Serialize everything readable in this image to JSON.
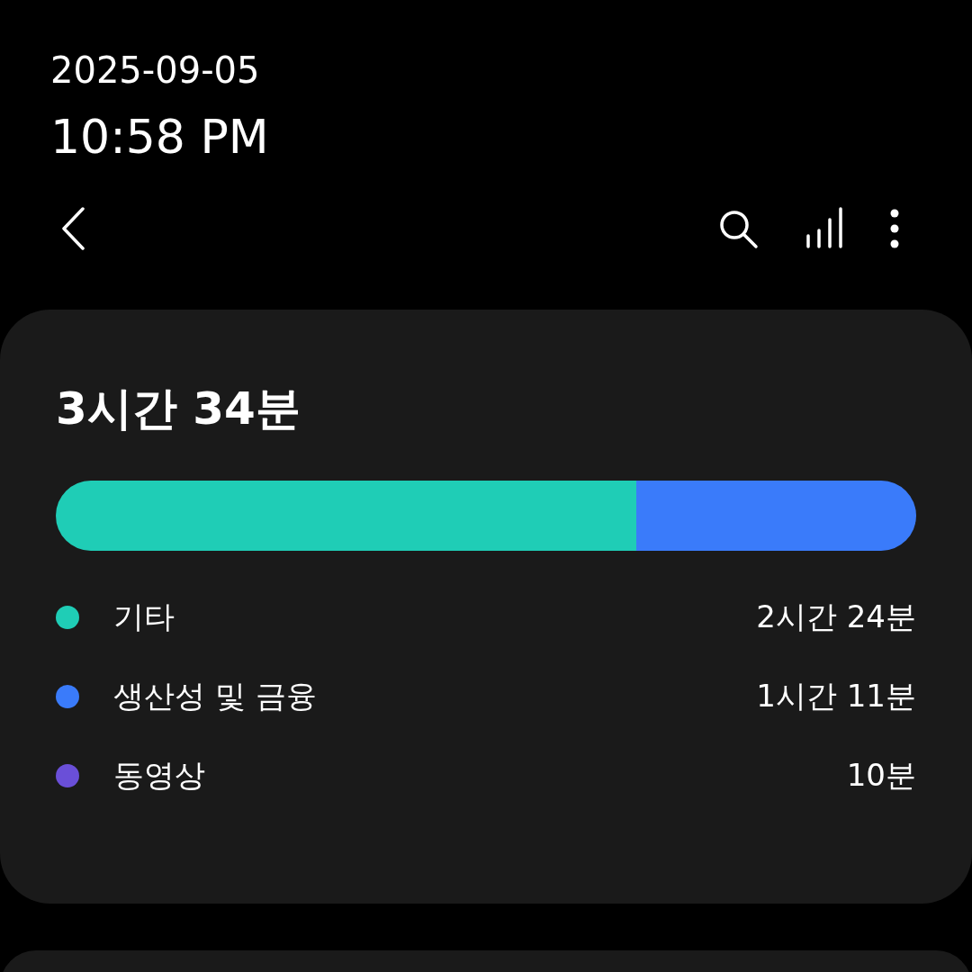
{
  "status": {
    "date": "2025-09-05",
    "time": "10:58 PM"
  },
  "summary": {
    "total": "3시간 34분",
    "categories": [
      {
        "name": "기타",
        "time": "2시간 24분",
        "color": "#1fcdb6",
        "level": 0.675
      },
      {
        "name": "생산성 및 금융",
        "time": "1시간 11분",
        "color": "#3a7bfa",
        "level": 0.325
      },
      {
        "name": "동영상",
        "time": "10분",
        "color": "#6a4fd8"
      }
    ]
  }
}
